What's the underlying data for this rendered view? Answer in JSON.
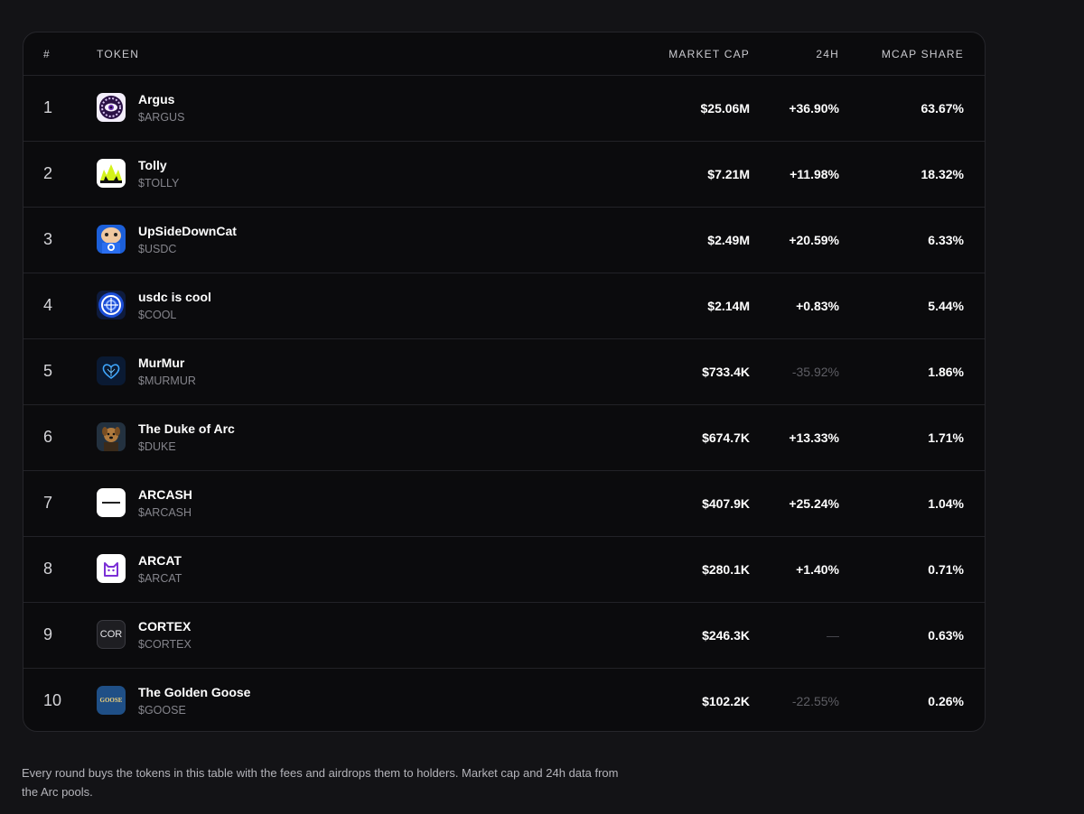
{
  "table": {
    "columns": {
      "rank": "#",
      "token": "TOKEN",
      "market_cap": "MARKET CAP",
      "change_24h": "24H",
      "mcap_share": "MCAP SHARE"
    },
    "rows": [
      {
        "rank": "1",
        "name": "Argus",
        "symbol": "$ARGUS",
        "market_cap": "$25.06M",
        "change": "+36.90%",
        "direction": "up",
        "share": "63.67%",
        "icon": "argus-eye-icon"
      },
      {
        "rank": "2",
        "name": "Tolly",
        "symbol": "$TOLLY",
        "market_cap": "$7.21M",
        "change": "+11.98%",
        "direction": "up",
        "share": "18.32%",
        "icon": "tolly-crown-icon"
      },
      {
        "rank": "3",
        "name": "UpSideDownCat",
        "symbol": "$USDC",
        "market_cap": "$2.49M",
        "change": "+20.59%",
        "direction": "up",
        "share": "6.33%",
        "icon": "upside-down-cat-icon"
      },
      {
        "rank": "4",
        "name": "usdc is cool",
        "symbol": "$COOL",
        "market_cap": "$2.14M",
        "change": "+0.83%",
        "direction": "up",
        "share": "5.44%",
        "icon": "cool-coin-icon"
      },
      {
        "rank": "5",
        "name": "MurMur",
        "symbol": "$MURMUR",
        "market_cap": "$733.4K",
        "change": "-35.92%",
        "direction": "down",
        "share": "1.86%",
        "icon": "murmur-heart-icon"
      },
      {
        "rank": "6",
        "name": "The Duke of Arc",
        "symbol": "$DUKE",
        "market_cap": "$674.7K",
        "change": "+13.33%",
        "direction": "up",
        "share": "1.71%",
        "icon": "duke-dog-icon"
      },
      {
        "rank": "7",
        "name": "ARCASH",
        "symbol": "$ARCASH",
        "market_cap": "$407.9K",
        "change": "+25.24%",
        "direction": "up",
        "share": "1.04%",
        "icon": "arcash-logo-icon"
      },
      {
        "rank": "8",
        "name": "ARCAT",
        "symbol": "$ARCAT",
        "market_cap": "$280.1K",
        "change": "+1.40%",
        "direction": "up",
        "share": "0.71%",
        "icon": "arcat-cat-icon"
      },
      {
        "rank": "9",
        "name": "CORTEX",
        "symbol": "$CORTEX",
        "market_cap": "$246.3K",
        "change": "—",
        "direction": "flat",
        "share": "0.63%",
        "icon": "cortex-text-icon",
        "icon_text": "COR"
      },
      {
        "rank": "10",
        "name": "The Golden Goose",
        "symbol": "$GOOSE",
        "market_cap": "$102.2K",
        "change": "-22.55%",
        "direction": "down",
        "share": "0.26%",
        "icon": "golden-goose-icon",
        "icon_text": "GOOSE"
      }
    ]
  },
  "footnote": "Every round buys the tokens in this table with the fees and airdrops them to holders. Market cap and 24h data from the Arc pools.",
  "colors": {
    "background": "#131316",
    "card": "#0b0b0d",
    "border": "#26262b",
    "muted_text": "#85858c",
    "negative_change": "#5e5e64"
  }
}
